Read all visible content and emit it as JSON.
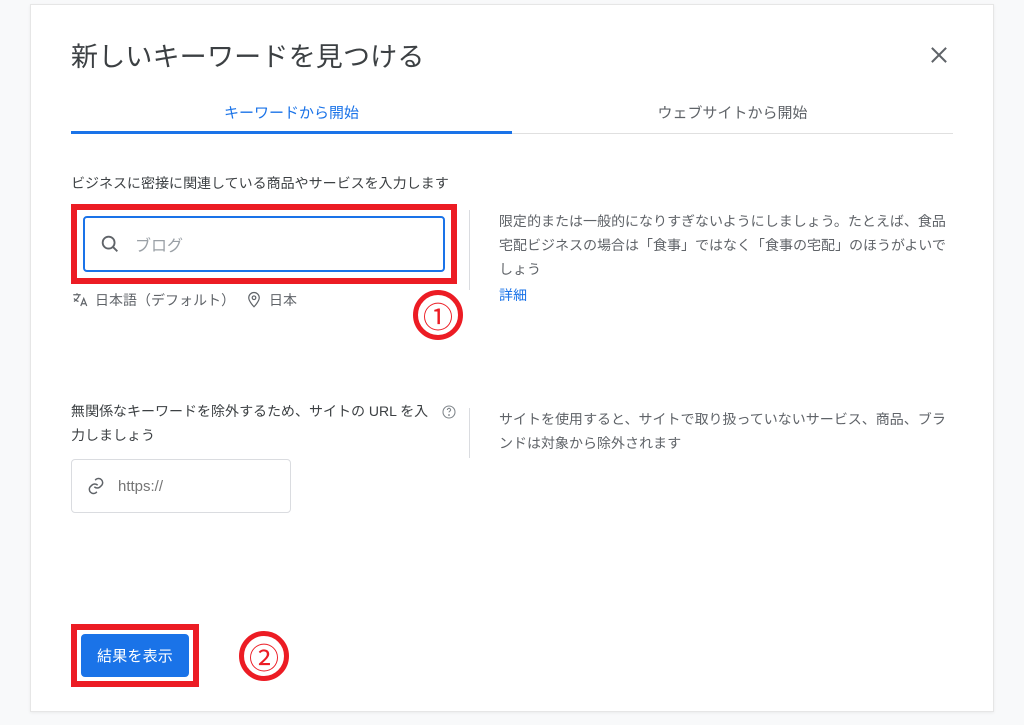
{
  "dialog": {
    "title": "新しいキーワードを見つける"
  },
  "tabs": {
    "start_keywords": "キーワードから開始",
    "start_website": "ウェブサイトから開始"
  },
  "section1": {
    "label": "ビジネスに密接に関連している商品やサービスを入力します",
    "input_value": "ブログ",
    "language": "日本語（デフォルト）",
    "location": "日本",
    "hint": "限定的または一般的になりすぎないようにしましょう。たとえば、食品宅配ビジネスの場合は「食事」ではなく「食事の宅配」のほうがよいでしょう",
    "details_link": "詳細"
  },
  "section2": {
    "label": "無関係なキーワードを除外するため、サイトの URL を入力しましょう",
    "placeholder": "https://",
    "hint": "サイトを使用すると、サイトで取り扱っていないサービス、商品、ブランドは対象から除外されます"
  },
  "footer": {
    "submit": "結果を表示"
  },
  "annotations": {
    "badge1": "①",
    "badge2": "②"
  }
}
